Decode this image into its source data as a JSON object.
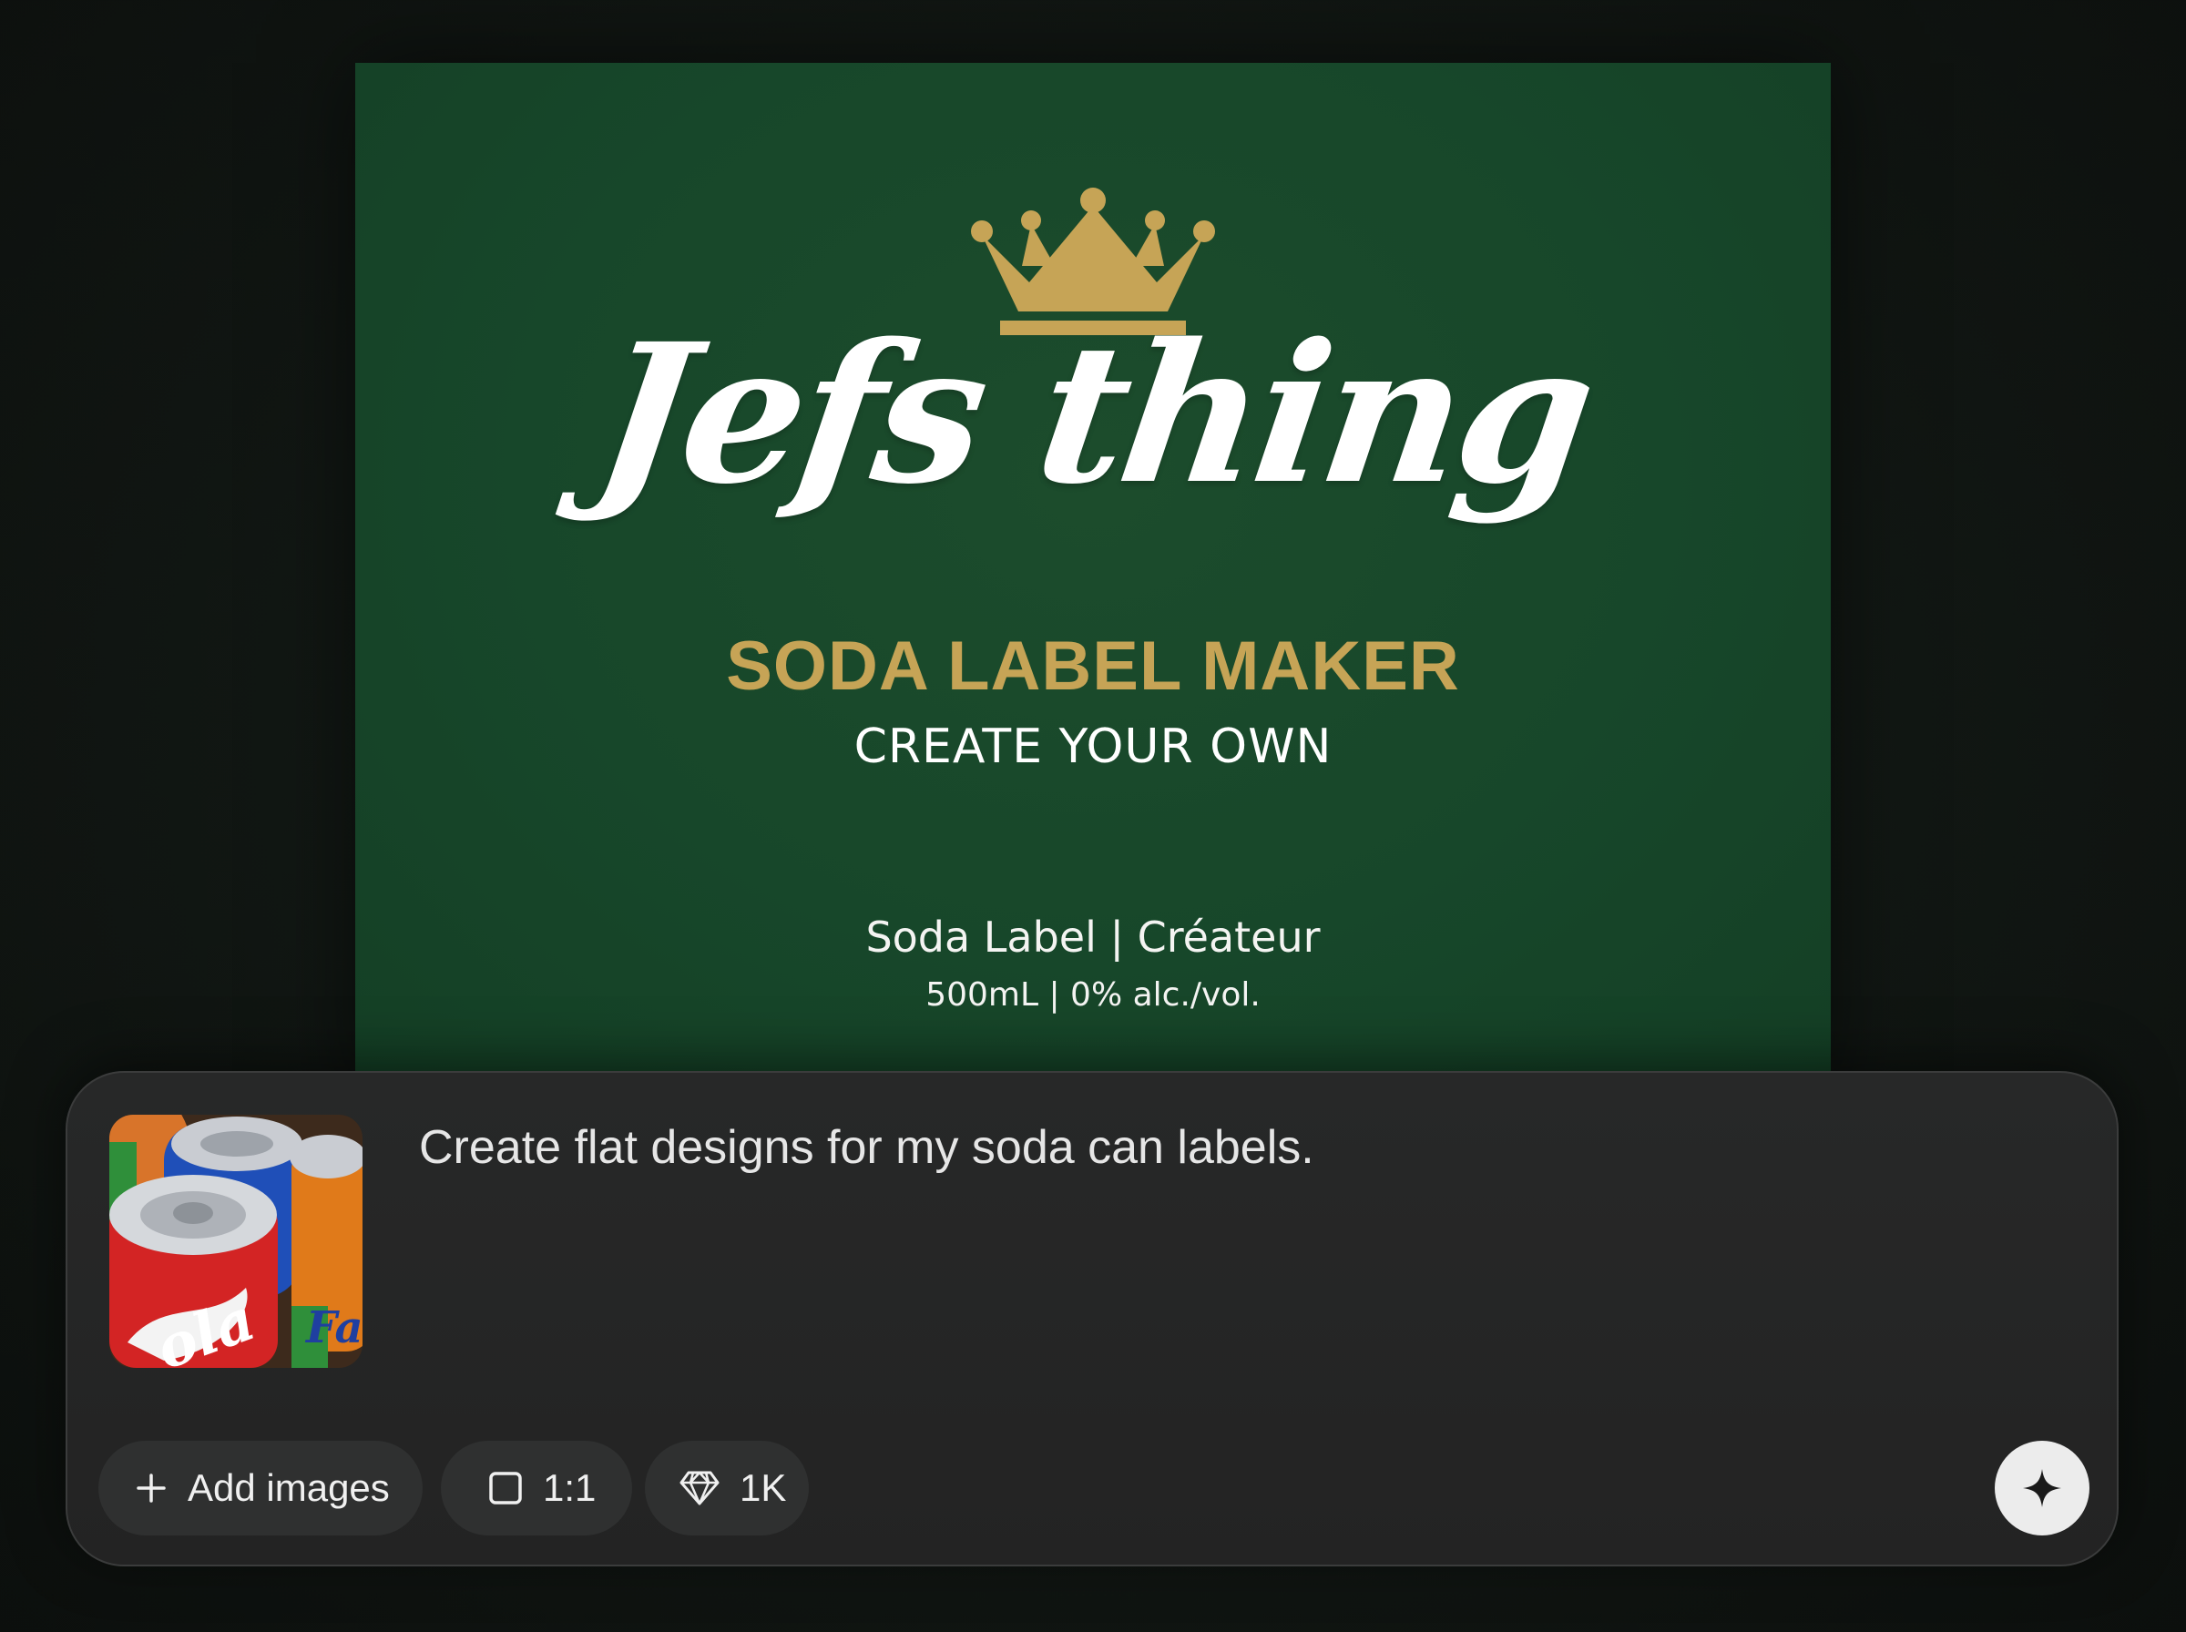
{
  "label": {
    "brand_title": "Jefs thing",
    "subtitle": "SODA LABEL MAKER",
    "tagline": "CREATE YOUR OWN",
    "product_line": "Soda Label | Créateur",
    "volume_line": "500mL | 0% alc./vol.",
    "colors": {
      "background": "#17472a",
      "gold": "#c6a456",
      "text": "#ffffff"
    },
    "icon": "crown-icon"
  },
  "prompt": {
    "thumbnail_icon": "soda-cans-image",
    "text": "Create flat designs for my soda can labels.",
    "add_images_label": "Add images",
    "add_images_icon": "plus-icon",
    "aspect_ratio_label": "1:1",
    "aspect_ratio_icon": "square-icon",
    "quality_label": "1K",
    "quality_icon": "diamond-icon",
    "send_icon": "sparkle-icon"
  }
}
